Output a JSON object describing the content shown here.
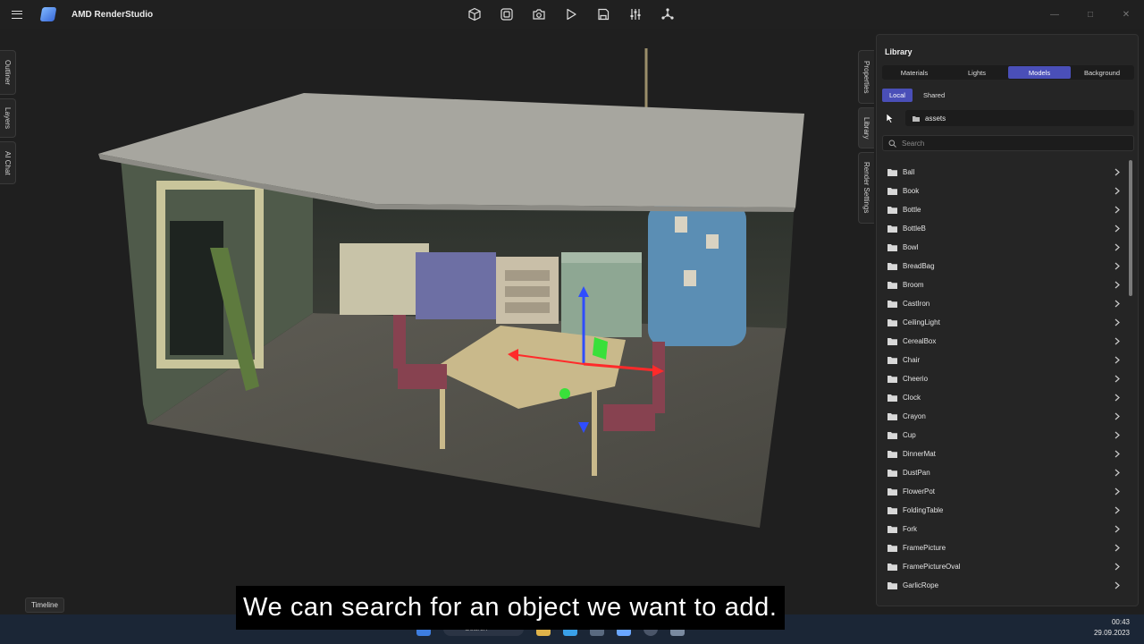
{
  "app": {
    "title": "AMD RenderStudio"
  },
  "toolbar": {
    "items": [
      "cube-icon",
      "frame-icon",
      "camera-icon",
      "play-icon",
      "save-icon",
      "sliders-icon",
      "network-icon"
    ]
  },
  "left_tabs": [
    "Outliner",
    "Layers",
    "AI Chat"
  ],
  "right_tabs": [
    "Properties",
    "Library",
    "Render Settings"
  ],
  "library": {
    "title": "Library",
    "tabs": [
      "Materials",
      "Lights",
      "Models",
      "Background"
    ],
    "active_tab": "Models",
    "subtabs": [
      "Local",
      "Shared"
    ],
    "active_subtab": "Local",
    "path": "assets",
    "search_placeholder": "Search",
    "items": [
      "Ball",
      "Book",
      "Bottle",
      "BottleB",
      "Bowl",
      "BreadBag",
      "Broom",
      "CastIron",
      "CeilingLight",
      "CerealBox",
      "Chair",
      "Cheerio",
      "Clock",
      "Crayon",
      "Cup",
      "DinnerMat",
      "DustPan",
      "FlowerPot",
      "FoldingTable",
      "Fork",
      "FramePicture",
      "FramePictureOval",
      "GarlicRope"
    ]
  },
  "timeline": {
    "label": "Timeline"
  },
  "caption": "We can search for an object we want to add.",
  "taskbar": {
    "search": "Search",
    "time": "00:43",
    "date": "29.09.2023"
  },
  "colors": {
    "accent": "#4a4fb8",
    "panel": "#252525",
    "background": "#1f1f1f"
  }
}
